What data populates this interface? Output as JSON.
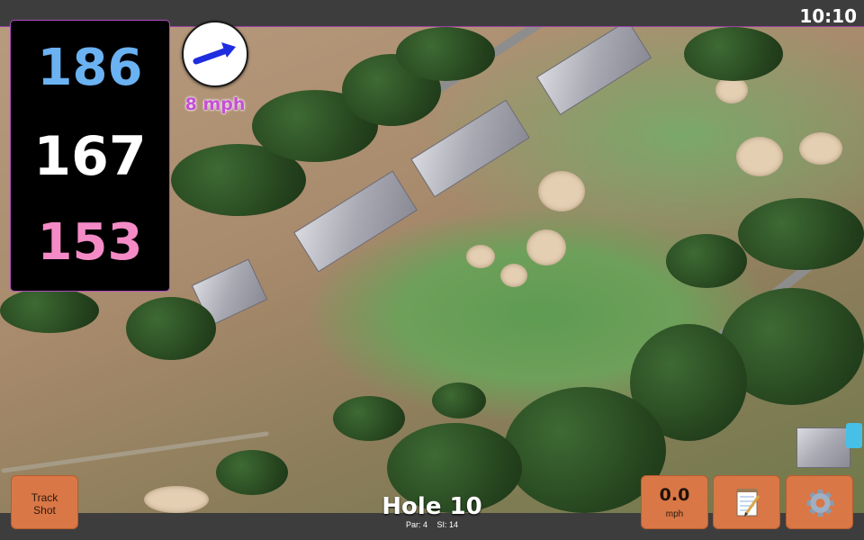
{
  "status_bar": {
    "clock": "10:10"
  },
  "distances": {
    "back": "186",
    "middle": "167",
    "front": "153"
  },
  "wind": {
    "speed": "8 mph",
    "icon": "wind-direction-arrow-icon"
  },
  "hole": {
    "title": "Hole 10",
    "par": "Par: 4",
    "stroke_index": "SI: 14"
  },
  "buttons": {
    "track_shot": {
      "line1": "Track",
      "line2": "Shot"
    },
    "speed": {
      "value": "0.0",
      "unit": "mph"
    },
    "notes": {
      "icon": "notepad-icon"
    },
    "settings": {
      "icon": "gear-icon"
    }
  },
  "colors": {
    "back_distance": "#6ab2f2",
    "middle_distance": "#ffffff",
    "front_distance": "#f48bc6",
    "wind_text": "#c54fd6",
    "button": "#d97746",
    "accent_border": "#b04cc0"
  }
}
